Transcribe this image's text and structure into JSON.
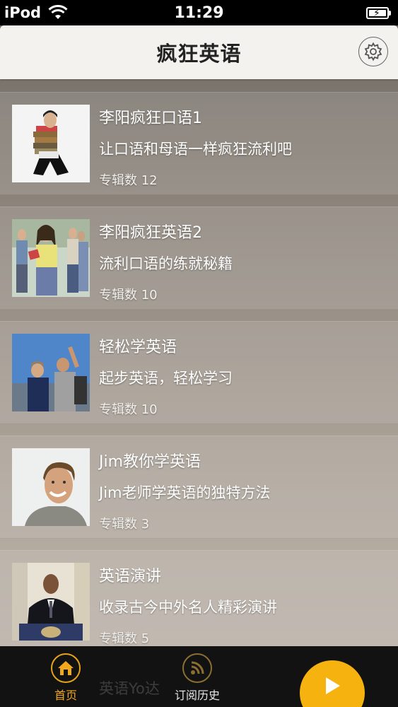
{
  "status_bar": {
    "carrier": "iPod",
    "time": "11:29"
  },
  "nav": {
    "title": "疯狂英语",
    "settings_icon": "gear-icon"
  },
  "albums": [
    {
      "title": "李阳疯狂口语1",
      "desc": "让口语和母语一样疯狂流利吧",
      "count": "专辑数 12"
    },
    {
      "title": "李阳疯狂英语2",
      "desc": "流利口语的练就秘籍",
      "count": "专辑数 10"
    },
    {
      "title": "轻松学英语",
      "desc": "起步英语，轻松学习",
      "count": "专辑数 10"
    },
    {
      "title": "Jim教你学英语",
      "desc": "Jim老师学英语的独特方法",
      "count": "专辑数 3"
    },
    {
      "title": "英语演讲",
      "desc": "收录古今中外名人精彩演讲",
      "count": "专辑数 5"
    }
  ],
  "peek_item": "英语Yo达",
  "tabs": {
    "home": {
      "label": "首页",
      "icon": "home-icon"
    },
    "history": {
      "label": "订阅历史",
      "icon": "rss-icon"
    },
    "play": {
      "icon": "play-icon"
    }
  },
  "colors": {
    "accent": "#f6b20f",
    "nav_bg": "#f3f2ee"
  }
}
